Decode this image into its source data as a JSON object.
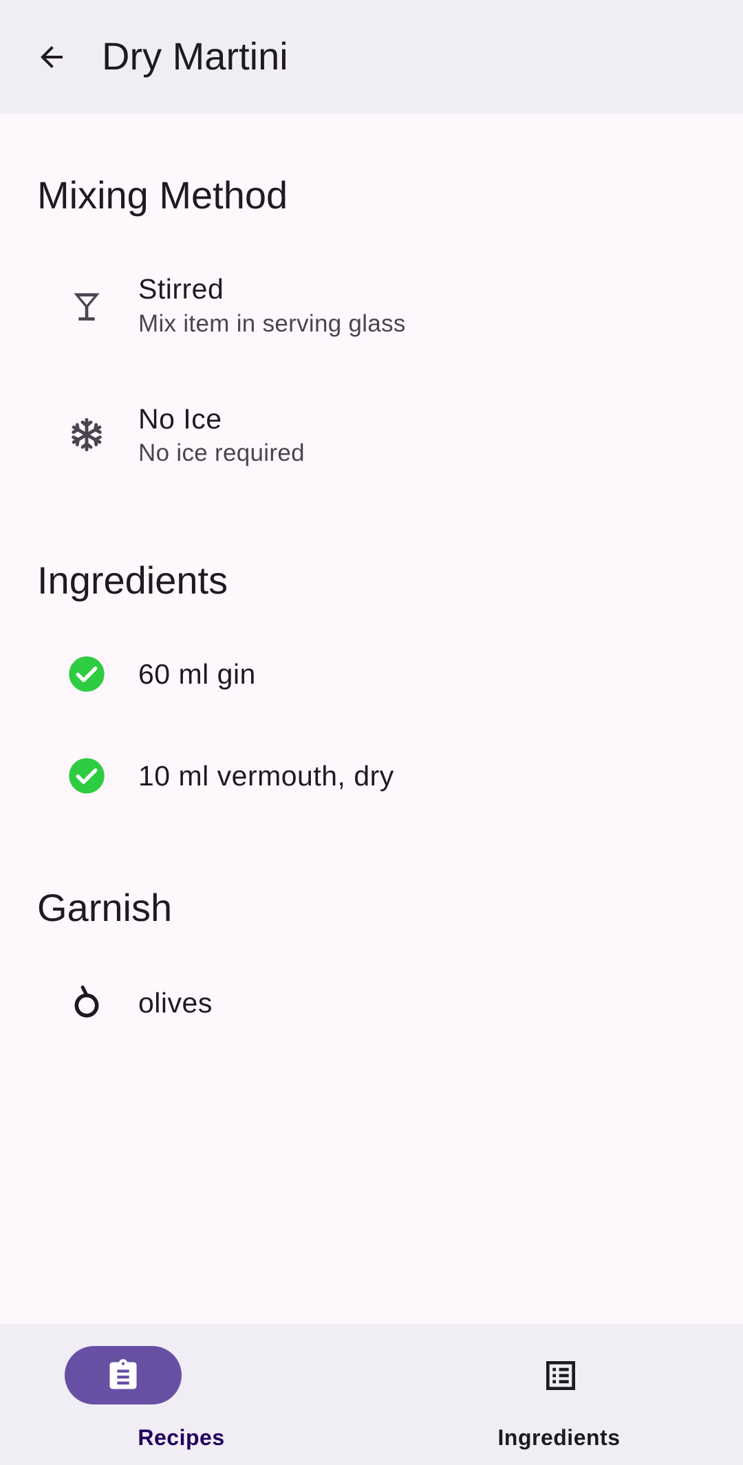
{
  "header": {
    "title": "Dry Martini",
    "back_icon": "arrow-back-icon"
  },
  "mixing_method": {
    "title": "Mixing Method",
    "items": [
      {
        "icon": "martini-glass-icon",
        "label": "Stirred",
        "description": "Mix item in serving glass"
      },
      {
        "icon": "snowflake-icon",
        "label": "No Ice",
        "description": "No ice required"
      }
    ]
  },
  "ingredients": {
    "title": "Ingredients",
    "items": [
      {
        "icon": "check-circle-icon",
        "label": "60 ml gin"
      },
      {
        "icon": "check-circle-icon",
        "label": "10 ml vermouth, dry"
      }
    ],
    "check_color": "#2ecc40"
  },
  "garnish": {
    "title": "Garnish",
    "items": [
      {
        "icon": "fruit-icon",
        "label": "olives"
      }
    ]
  },
  "bottom_nav": {
    "items": [
      {
        "label": "Recipes",
        "icon": "recipe-clipboard-icon",
        "selected": true
      },
      {
        "label": "Ingredients",
        "icon": "list-icon",
        "selected": false
      }
    ],
    "accent_color": "#6750a4",
    "selected_label_color": "#21005d"
  }
}
